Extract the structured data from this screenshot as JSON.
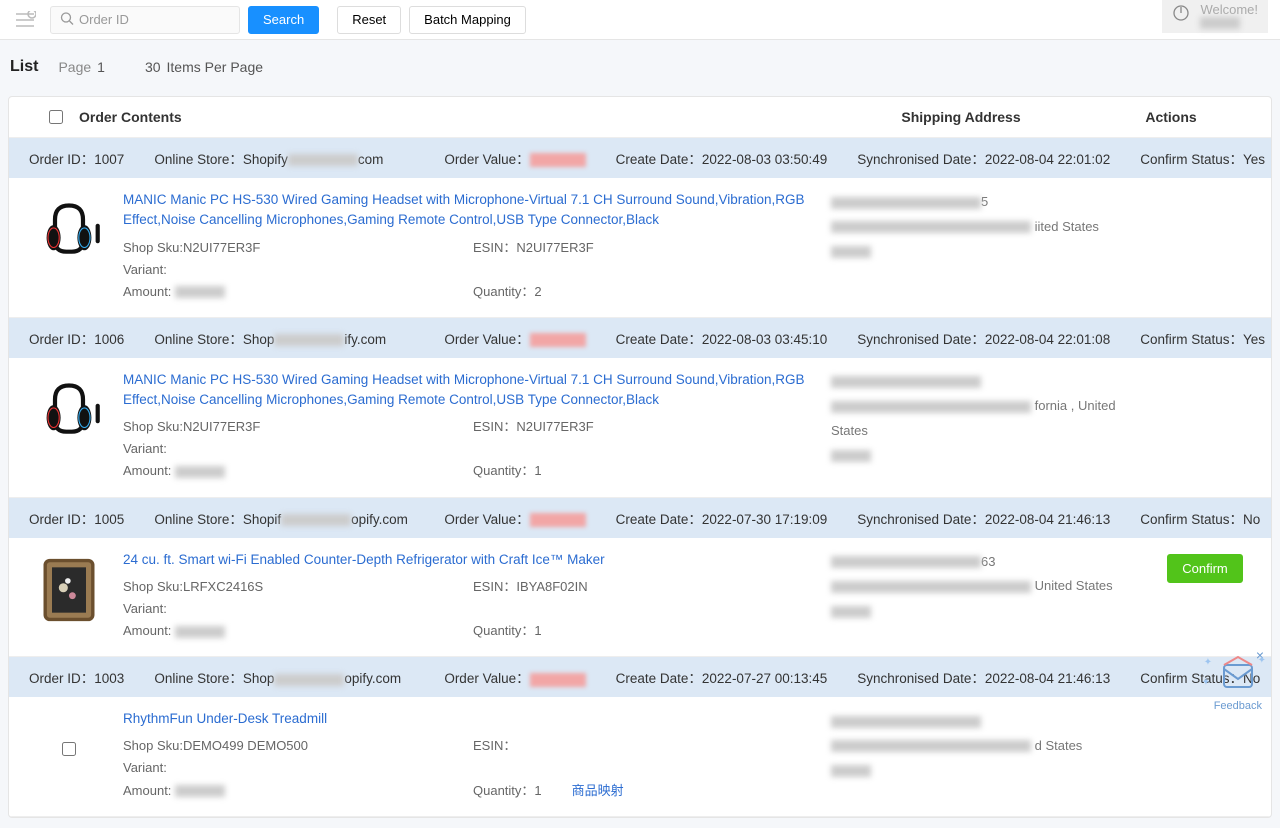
{
  "topbar": {
    "search_placeholder": "Order ID",
    "search_label": "Search",
    "reset_label": "Reset",
    "batch_label": "Batch Mapping",
    "welcome": "Welcome!"
  },
  "list": {
    "title": "List",
    "page_label": "Page",
    "page": "1",
    "ipp": "30",
    "ipp_label": "Items Per Page"
  },
  "table": {
    "contents_label": "Order Contents",
    "addr_label": "Shipping Address",
    "actions_label": "Actions"
  },
  "labels": {
    "order_id": "Order ID：",
    "online_store": "Online Store：",
    "order_value": "Order Value：",
    "create_date": "Create Date：",
    "sync_date": "Synchronised Date：",
    "confirm_status": "Confirm Status：",
    "shop_sku": "Shop Sku:",
    "variant": "Variant:",
    "amount": "Amount:",
    "esin": "ESIN：",
    "quantity": "Quantity：",
    "confirm_btn": "Confirm",
    "mapping": "商品映射"
  },
  "orders": [
    {
      "id": "1007",
      "store_prefix": "Shopify",
      "store_suffix": "com",
      "create_date": "2022-08-03 03:50:49",
      "sync_date": "2022-08-04 22:01:02",
      "confirm": "Yes",
      "title": "MANIC Manic PC HS-530 Wired Gaming Headset with Microphone-Virtual 7.1 CH Surround Sound,Vibration,RGB Effect,Noise Cancelling Microphones,Gaming Remote Control,USB Type Connector,Black",
      "sku": "N2UI77ER3F",
      "esin": "N2UI77ER3F",
      "qty": "2",
      "addr_suffix1": "5",
      "addr_suffix2": "iited States",
      "show_confirm": false,
      "img": "headset"
    },
    {
      "id": "1006",
      "store_prefix": "Shop",
      "store_suffix": "ify.com",
      "create_date": "2022-08-03 03:45:10",
      "sync_date": "2022-08-04 22:01:08",
      "confirm": "Yes",
      "title": "MANIC Manic PC HS-530 Wired Gaming Headset with Microphone-Virtual 7.1 CH Surround Sound,Vibration,RGB Effect,Noise Cancelling Microphones,Gaming Remote Control,USB Type Connector,Black",
      "sku": "N2UI77ER3F",
      "esin": "N2UI77ER3F",
      "qty": "1",
      "addr_suffix1": "",
      "addr_suffix2": "fornia , United States",
      "show_confirm": false,
      "img": "headset"
    },
    {
      "id": "1005",
      "store_prefix": "Shopif",
      "store_suffix": "opify.com",
      "create_date": "2022-07-30 17:19:09",
      "sync_date": "2022-08-04 21:46:13",
      "confirm": "No",
      "title": "24 cu. ft. Smart wi-Fi Enabled Counter-Depth Refrigerator with Craft Ice™ Maker",
      "sku": "LRFXC2416S",
      "esin": "IBYA8F02IN",
      "qty": "1",
      "addr_suffix1": "63",
      "addr_suffix2": "United States",
      "show_confirm": true,
      "img": "frame"
    },
    {
      "id": "1003",
      "store_prefix": "Shop",
      "store_suffix": "opify.com",
      "create_date": "2022-07-27 00:13:45",
      "sync_date": "2022-08-04 21:46:13",
      "confirm": "No",
      "title": "RhythmFun Under-Desk Treadmill",
      "sku": "DEMO499 DEMO500",
      "esin": "",
      "qty": "1",
      "addr_suffix1": "",
      "addr_suffix2": "d States",
      "show_confirm": false,
      "show_mapping": true,
      "img": "none"
    }
  ],
  "feedback": {
    "label": "Feedback"
  }
}
